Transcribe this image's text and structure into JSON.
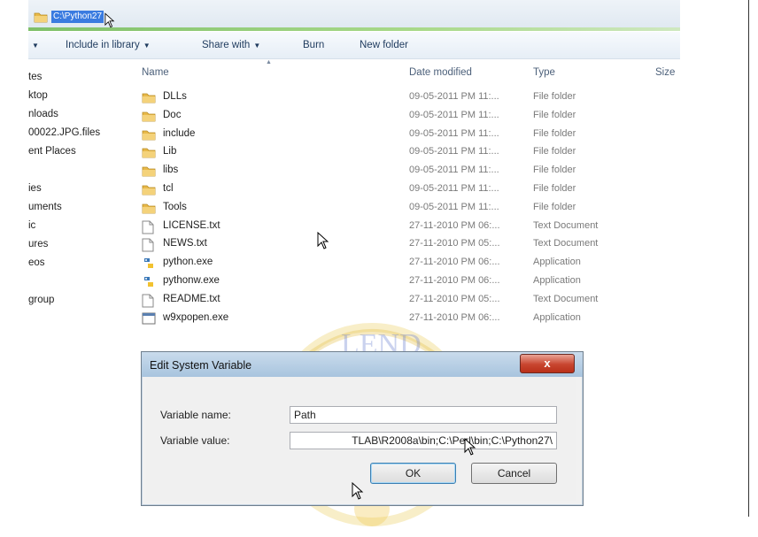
{
  "explorer": {
    "address_path": "C:\\Python27",
    "toolbar": {
      "include_in_library": "Include in library",
      "share_with": "Share with",
      "burn": "Burn",
      "new_folder": "New folder"
    },
    "nav_items": [
      "tes",
      "ktop",
      "nloads",
      "00022.JPG.files",
      "ent Places",
      "ies",
      "uments",
      "ic",
      "ures",
      "eos",
      "group"
    ],
    "columns": {
      "name": "Name",
      "date_modified": "Date modified",
      "type": "Type",
      "size": "Size"
    },
    "files": [
      {
        "name": "DLLs",
        "date": "09-05-2011 PM 11:...",
        "type": "File folder",
        "icon": "folder-icon"
      },
      {
        "name": "Doc",
        "date": "09-05-2011 PM 11:...",
        "type": "File folder",
        "icon": "folder-icon"
      },
      {
        "name": "include",
        "date": "09-05-2011 PM 11:...",
        "type": "File folder",
        "icon": "folder-icon"
      },
      {
        "name": "Lib",
        "date": "09-05-2011 PM 11:...",
        "type": "File folder",
        "icon": "folder-icon"
      },
      {
        "name": "libs",
        "date": "09-05-2011 PM 11:...",
        "type": "File folder",
        "icon": "folder-icon"
      },
      {
        "name": "tcl",
        "date": "09-05-2011 PM 11:...",
        "type": "File folder",
        "icon": "folder-icon"
      },
      {
        "name": "Tools",
        "date": "09-05-2011 PM 11:...",
        "type": "File folder",
        "icon": "folder-icon"
      },
      {
        "name": "LICENSE.txt",
        "date": "27-11-2010 PM 06:...",
        "type": "Text Document",
        "icon": "text-document-icon"
      },
      {
        "name": "NEWS.txt",
        "date": "27-11-2010 PM 05:...",
        "type": "Text Document",
        "icon": "text-document-icon"
      },
      {
        "name": "python.exe",
        "date": "27-11-2010 PM 06:...",
        "type": "Application",
        "icon": "python-icon"
      },
      {
        "name": "pythonw.exe",
        "date": "27-11-2010 PM 06:...",
        "type": "Application",
        "icon": "python-icon"
      },
      {
        "name": "README.txt",
        "date": "27-11-2010 PM 05:...",
        "type": "Text Document",
        "icon": "text-document-icon"
      },
      {
        "name": "w9xpopen.exe",
        "date": "27-11-2010 PM 06:...",
        "type": "Application",
        "icon": "application-icon"
      }
    ]
  },
  "dialog": {
    "title": "Edit System Variable",
    "close_label": "x",
    "variable_name_label": "Variable name:",
    "variable_name_value": "Path",
    "variable_value_label": "Variable value:",
    "variable_value_value": "\\TLAB\\R2008a\\bin;C:\\Perl\\bin;C:\\Python27",
    "ok_label": "OK",
    "cancel_label": "Cancel"
  },
  "colors": {
    "selection_blue": "#3a7be0",
    "close_red": "#c8452f",
    "folder_yellow": "#e8b94a",
    "watermark_gold": "#e6c04a",
    "watermark_blue": "#6a7fd0"
  }
}
